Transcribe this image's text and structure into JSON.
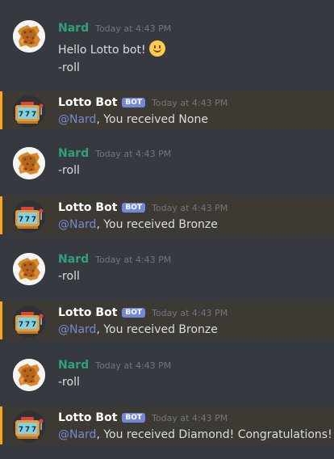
{
  "messages": [
    {
      "author": "Nard",
      "timestamp": "Today at 4:43 PM",
      "lines": [
        "Hello Lotto bot!",
        "-roll"
      ]
    },
    {
      "author": "Lotto Bot",
      "bot_tag": "BOT",
      "timestamp": "Today at 4:43 PM",
      "mention": "@Nard",
      "text": ", You received None"
    },
    {
      "author": "Nard",
      "timestamp": "Today at 4:43 PM",
      "lines": [
        "-roll"
      ]
    },
    {
      "author": "Lotto Bot",
      "bot_tag": "BOT",
      "timestamp": "Today at 4:43 PM",
      "mention": "@Nard",
      "text": ", You received Bronze"
    },
    {
      "author": "Nard",
      "timestamp": "Today at 4:43 PM",
      "lines": [
        "-roll"
      ]
    },
    {
      "author": "Lotto Bot",
      "bot_tag": "BOT",
      "timestamp": "Today at 4:43 PM",
      "mention": "@Nard",
      "text": ", You received Bronze"
    },
    {
      "author": "Nard",
      "timestamp": "Today at 4:43 PM",
      "lines": [
        "-roll"
      ]
    },
    {
      "author": "Lotto Bot",
      "bot_tag": "BOT",
      "timestamp": "Today at 4:43 PM",
      "mention": "@Nard",
      "text": ", You received Diamond! Congratulations!"
    }
  ],
  "icons": {
    "user_avatar": "cheese-cracker-avatar-icon",
    "bot_avatar": "slot-machine-777-icon",
    "emoji": "slightly-smiling-face-icon"
  },
  "colors": {
    "background": "#36393f",
    "user_name": "#2ea27a",
    "bot_tag": "#7289da",
    "mention": "#7289da",
    "highlight_border": "#faa61a"
  }
}
